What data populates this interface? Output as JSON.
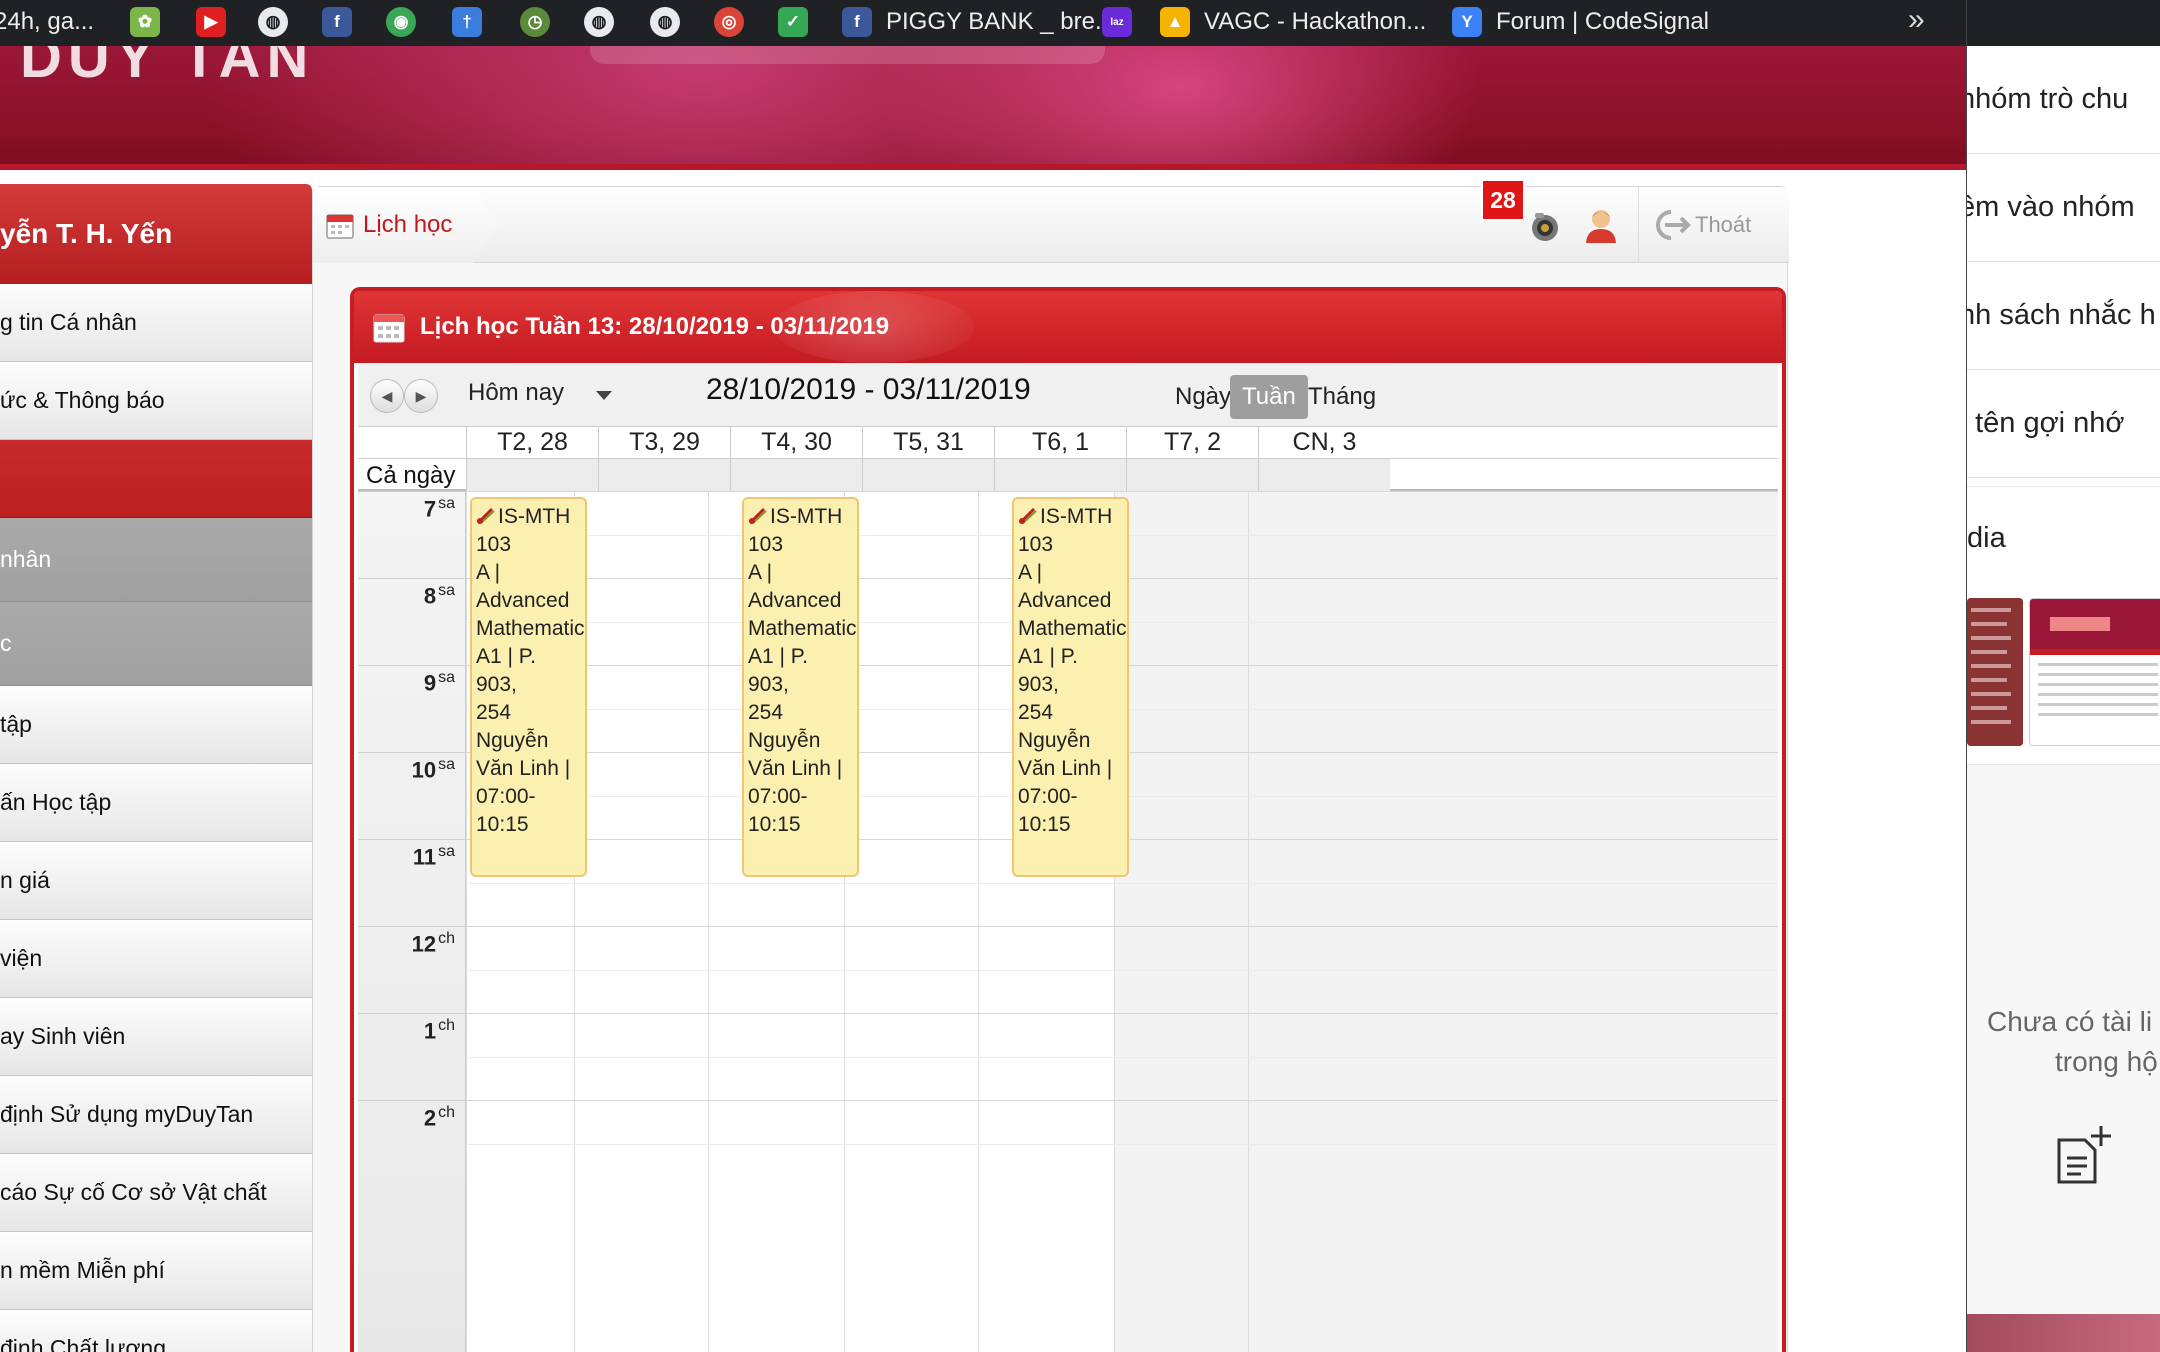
{
  "bookmarks": [
    {
      "icon": "partial-tab-icon",
      "label": "24h, ga..."
    },
    {
      "icon": "leaf-icon",
      "label": ""
    },
    {
      "icon": "youtube-icon",
      "label": ""
    },
    {
      "icon": "globe-icon",
      "label": ""
    },
    {
      "icon": "facebook-icon",
      "label": ""
    },
    {
      "icon": "colorful-chart-icon",
      "label": ""
    },
    {
      "icon": "pin-icon",
      "label": ""
    },
    {
      "icon": "clock-icon",
      "label": ""
    },
    {
      "icon": "globe-icon",
      "label": ""
    },
    {
      "icon": "globe-icon",
      "label": ""
    },
    {
      "icon": "chrome-icon",
      "label": ""
    },
    {
      "icon": "map-pin-icon",
      "label": ""
    },
    {
      "icon": "facebook-icon",
      "label": "PIGGY BANK _ bre..."
    },
    {
      "icon": "lazada-icon",
      "label": ""
    },
    {
      "icon": "google-drive-icon",
      "label": "VAGC - Hackathon..."
    },
    {
      "icon": "codesignal-icon",
      "label": "Forum | CodeSignal"
    }
  ],
  "bookmarks_more": "»",
  "sidebar": {
    "user_name": "yễn T. H. Yến",
    "items": [
      {
        "label": "g tin Cá nhân",
        "style": "normal"
      },
      {
        "label": "ức & Thông báo",
        "style": "normal"
      },
      {
        "label": "",
        "style": "red"
      },
      {
        "label": "nhân",
        "style": "grey"
      },
      {
        "label": "c",
        "style": "grey"
      },
      {
        "label": "tập",
        "style": "normal"
      },
      {
        "label": "ấn Học tập",
        "style": "normal"
      },
      {
        "label": "n giá",
        "style": "normal"
      },
      {
        "label": "viện",
        "style": "normal"
      },
      {
        "label": "ay Sinh viên",
        "style": "normal"
      },
      {
        "label": "định Sử dụng myDuyTan",
        "style": "normal"
      },
      {
        "label": "cáo Sự cố Cơ sở Vật chất",
        "style": "normal"
      },
      {
        "label": "n mềm Miễn phí",
        "style": "normal"
      },
      {
        "label": " định Chất lượng",
        "style": "normal"
      }
    ]
  },
  "topbar": {
    "breadcrumb": "Lịch học",
    "notification_count": "28",
    "logout_label": "Thoát"
  },
  "calendar": {
    "header_title": "Lịch học Tuần 13: 28/10/2019 - 03/11/2019",
    "today_label": "Hôm nay",
    "range_title": "28/10/2019 - 03/11/2019",
    "views": [
      {
        "label": "Ngày",
        "active": false
      },
      {
        "label": "Tuần",
        "active": true
      },
      {
        "label": "Tháng",
        "active": false
      }
    ],
    "days": [
      "T2, 28",
      "T3, 29",
      "T4, 30",
      "T5, 31",
      "T6, 1",
      "T7, 2",
      "CN, 3"
    ],
    "all_day_label": "Cả ngày",
    "hours": [
      {
        "h": "7",
        "s": "sa"
      },
      {
        "h": "8",
        "s": "sa"
      },
      {
        "h": "9",
        "s": "sa"
      },
      {
        "h": "10",
        "s": "sa"
      },
      {
        "h": "11",
        "s": "sa"
      },
      {
        "h": "12",
        "s": "ch"
      },
      {
        "h": "1",
        "s": "ch"
      },
      {
        "h": "2",
        "s": "ch"
      }
    ],
    "events": [
      {
        "day": 0,
        "lines": [
          "IS-MTH 103",
          "A | Advanced",
          "Mathematics",
          "A1 | P. 903,",
          "254 Nguyễn",
          "Văn Linh |",
          "07:00-10:15"
        ],
        "color": "#fcf0b0"
      },
      {
        "day": 2,
        "lines": [
          "IS-MTH 103",
          "A | Advanced",
          "Mathematics",
          "A1 | P. 903,",
          "254 Nguyễn",
          "Văn Linh |",
          "07:00-10:15"
        ],
        "color": "#fcf0b0"
      },
      {
        "day": 4,
        "lines": [
          "IS-MTH 103",
          "A | Advanced",
          "Mathematics",
          "A1 | P. 903,",
          "254 Nguyễn",
          "Văn Linh |",
          "07:00-10:15"
        ],
        "color": "#fcf0b0"
      }
    ]
  },
  "right_panel": {
    "items": [
      "nhóm trò chu",
      "êm vào nhóm",
      "nh sách nhắc h",
      "t tên gợi nhớ"
    ],
    "media_label": "dia",
    "empty_line1": "Chưa có tài li",
    "empty_line2": "trong hộ"
  },
  "colors": {
    "accent_red": "#c41d23",
    "event_bg": "#fcf0b0",
    "event_border": "#f0c470"
  }
}
